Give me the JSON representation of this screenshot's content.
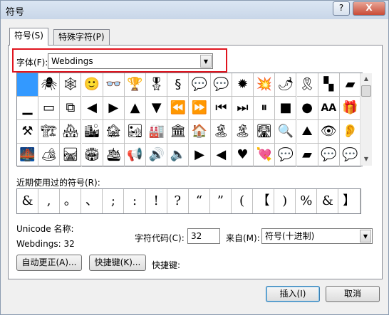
{
  "window": {
    "title": "符号",
    "help_glyph": "?",
    "close_glyph": "X"
  },
  "tabs": [
    {
      "label": "符号(S)"
    },
    {
      "label": "特殊字符(P)"
    }
  ],
  "font": {
    "label": "字体(F):",
    "value": "Webdings"
  },
  "symbol_grid": {
    "symbols": [
      "",
      "🕷",
      "🕸",
      "🙂",
      "👓",
      "🏆",
      "🎖",
      "§",
      "💬",
      "💬",
      "✹",
      "💥",
      "🌶",
      "🎗",
      "▚",
      "▰",
      "▁",
      "▭",
      "⧉",
      "◀",
      "▶",
      "▲",
      "▼",
      "⏪",
      "⏩",
      "⏮",
      "⏭",
      "⏸",
      "■",
      "●",
      "AA",
      "🎁",
      "⚒",
      "🏗",
      "🏘",
      "🏙",
      "🏚",
      "🏜",
      "🏭",
      "🏛",
      "🏠",
      "🏝",
      "🏝",
      "🛣",
      "🔍",
      "⛰",
      "👁",
      "👂",
      "🌉",
      "🏕",
      "🛤",
      "🏟",
      "🛳",
      "📢",
      "🔊",
      "🔈",
      "▶",
      "◀",
      "♥",
      "💘",
      "💬",
      "▰",
      "💬",
      "💬"
    ],
    "selected_index": 0
  },
  "recent": {
    "label": "近期使用过的符号(R):",
    "symbols": [
      "&",
      ",",
      "。",
      "、",
      ";",
      ":",
      "!",
      "?",
      "“",
      "”",
      "(",
      "【",
      ")",
      "%",
      "&",
      "】"
    ]
  },
  "info": {
    "unicode_name_label": "Unicode 名称:",
    "char_name": "Webdings: 32",
    "char_code_label": "字符代码(C):",
    "char_code_value": "32",
    "from_label": "来自(M):",
    "from_value": "符号(十进制)"
  },
  "buttons": {
    "autocorrect": "自动更正(A)...",
    "shortcut_key": "快捷键(K)...",
    "shortcut_label": "快捷键:",
    "insert": "插入(I)",
    "cancel": "取消"
  }
}
